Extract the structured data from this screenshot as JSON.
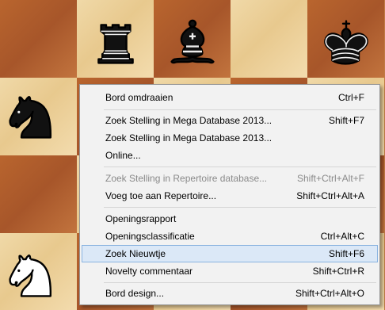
{
  "context_menu": {
    "items": [
      {
        "label": "Bord omdraaien",
        "shortcut": "Ctrl+F",
        "disabled": false,
        "highlighted": false
      },
      {
        "label": "Zoek Stelling in Mega Database 2013...",
        "shortcut": "Shift+F7",
        "disabled": false,
        "highlighted": false
      },
      {
        "label": "Zoek Stelling in Mega Database 2013...",
        "shortcut": "",
        "disabled": false,
        "highlighted": false
      },
      {
        "label": "Online...",
        "shortcut": "",
        "disabled": false,
        "highlighted": false
      },
      {
        "label": "Zoek Stelling in Repertoire database...",
        "shortcut": "Shift+Ctrl+Alt+F",
        "disabled": true,
        "highlighted": false
      },
      {
        "label": "Voeg toe aan Repertoire...",
        "shortcut": "Shift+Ctrl+Alt+A",
        "disabled": false,
        "highlighted": false
      },
      {
        "label": "Openingsrapport",
        "shortcut": "",
        "disabled": false,
        "highlighted": false
      },
      {
        "label": "Openingsclassificatie",
        "shortcut": "Ctrl+Alt+C",
        "disabled": false,
        "highlighted": false
      },
      {
        "label": "Zoek Nieuwtje",
        "shortcut": "Shift+F6",
        "disabled": false,
        "highlighted": true
      },
      {
        "label": "Novelty commentaar",
        "shortcut": "Shift+Ctrl+R",
        "disabled": false,
        "highlighted": false
      },
      {
        "label": "Bord design...",
        "shortcut": "Shift+Ctrl+Alt+O",
        "disabled": false,
        "highlighted": false
      }
    ]
  },
  "board": {
    "pieces": [
      "black-rook",
      "black-bishop",
      "black-king",
      "black-knight",
      "white-knight"
    ],
    "colors": {
      "light": "#f0d9a8",
      "dark": "#b0602c",
      "highlight": "#dbe8f7",
      "highlight_border": "#8ab3e0"
    }
  }
}
